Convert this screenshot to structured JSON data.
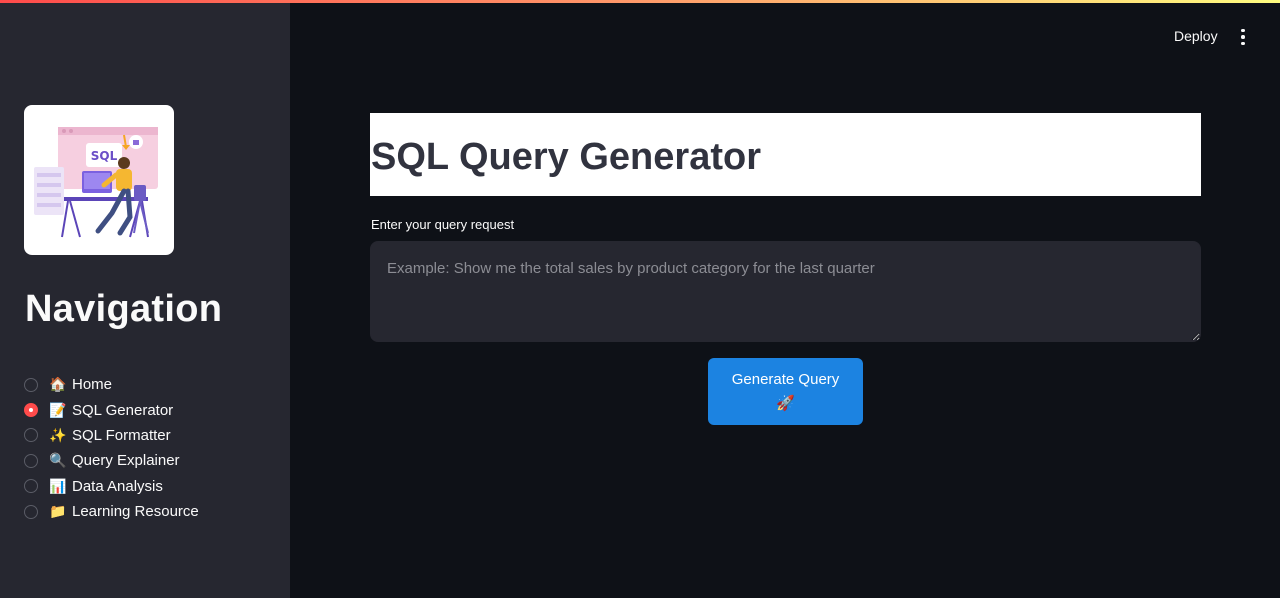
{
  "colors": {
    "sidebar_bg": "#262730",
    "main_bg": "#0e1117",
    "accent_radio": "#ff4b4b",
    "primary_button": "#1c83e1",
    "title_box_bg": "#ffffff",
    "title_text": "#31333f"
  },
  "header": {
    "deploy_label": "Deploy",
    "menu_icon": "vertical-ellipsis-icon"
  },
  "sidebar": {
    "logo_icon": "sql-developer-illustration",
    "logo_text": "SQL",
    "title": "Navigation",
    "items": [
      {
        "emoji": "🏠",
        "label": "Home",
        "selected": false
      },
      {
        "emoji": "📝",
        "label": "SQL Generator",
        "selected": true
      },
      {
        "emoji": "✨",
        "label": "SQL Formatter",
        "selected": false
      },
      {
        "emoji": "🔍",
        "label": "Query Explainer",
        "selected": false
      },
      {
        "emoji": "📊",
        "label": "Data Analysis",
        "selected": false
      },
      {
        "emoji": "📁",
        "label": "Learning Resource",
        "selected": false
      }
    ]
  },
  "main": {
    "title": "SQL Query Generator",
    "input_label": "Enter your query request",
    "input_value": "",
    "input_placeholder": "Example: Show me the total sales by product category for the last quarter",
    "generate_button_label": "Generate Query",
    "generate_button_emoji": "🚀"
  }
}
